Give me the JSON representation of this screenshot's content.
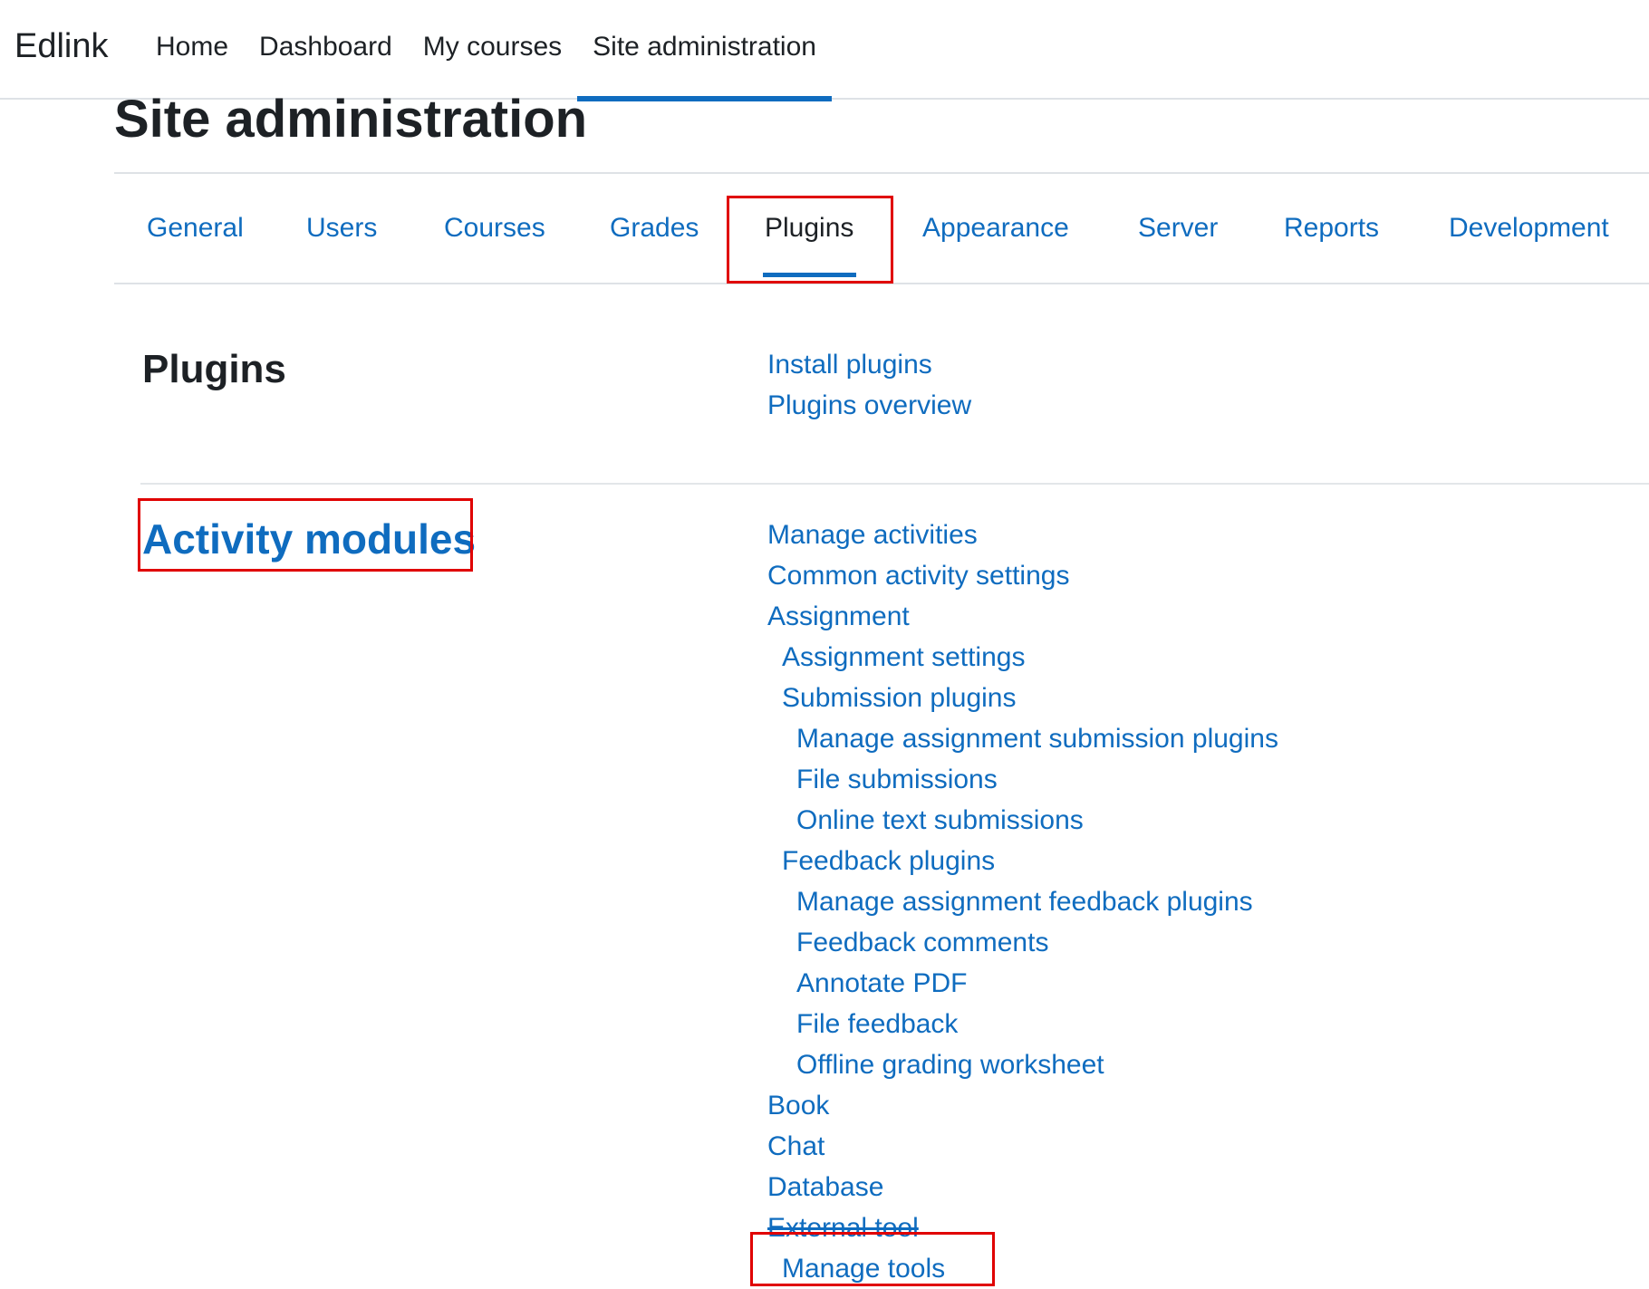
{
  "navbar": {
    "brand": "Edlink",
    "links": [
      {
        "label": "Home"
      },
      {
        "label": "Dashboard"
      },
      {
        "label": "My courses"
      },
      {
        "label": "Site administration",
        "active": true
      }
    ]
  },
  "page": {
    "title": "Site administration"
  },
  "tabs": [
    {
      "label": "General"
    },
    {
      "label": "Users"
    },
    {
      "label": "Courses"
    },
    {
      "label": "Grades"
    },
    {
      "label": "Plugins",
      "active": true
    },
    {
      "label": "Appearance"
    },
    {
      "label": "Server"
    },
    {
      "label": "Reports"
    },
    {
      "label": "Development"
    }
  ],
  "sections": {
    "plugins": {
      "title": "Plugins",
      "links": [
        "Install plugins",
        "Plugins overview"
      ]
    },
    "activity_modules": {
      "title": "Activity modules",
      "links": [
        "Manage activities",
        "Common activity settings",
        "Assignment",
        "Assignment settings",
        "Submission plugins",
        "Manage assignment submission plugins",
        "File submissions",
        "Online text submissions",
        "Feedback plugins",
        "Manage assignment feedback plugins",
        "Feedback comments",
        "Annotate PDF",
        "File feedback",
        "Offline grading worksheet",
        "Book",
        "Chat",
        "Database",
        "External tool",
        "Manage tools"
      ]
    }
  },
  "colors": {
    "link": "#0f6cbf",
    "text": "#1d2125",
    "highlight": "#e00000"
  }
}
